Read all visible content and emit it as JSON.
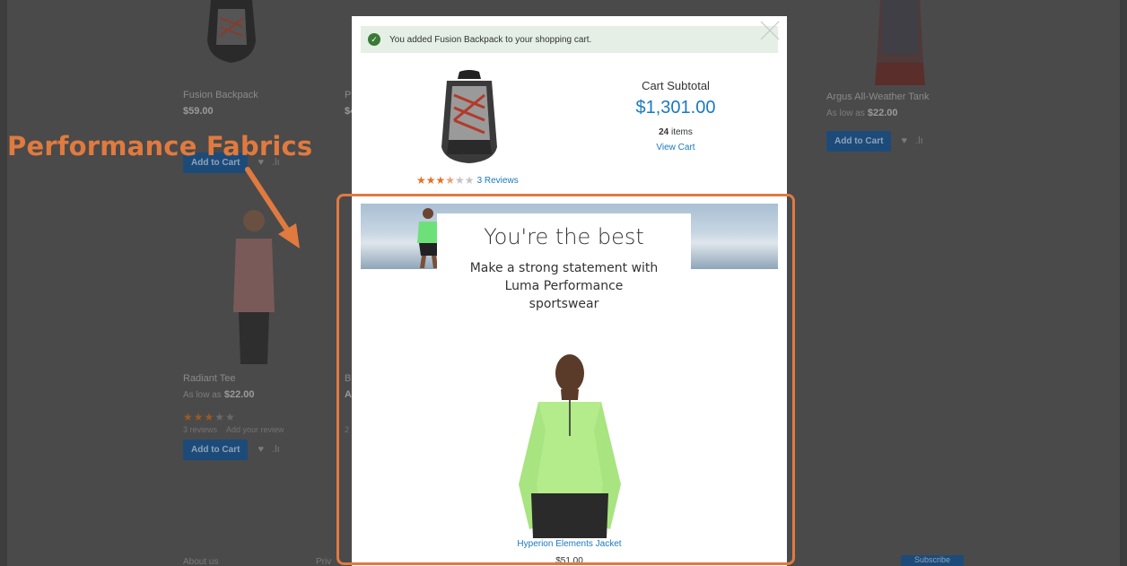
{
  "background_page": {
    "products_row1": [
      {
        "name": "Fusion Backpack",
        "price": "$59.00",
        "add_label": "Add to Cart"
      },
      {
        "name": "Argus All-Weather Tank",
        "price_prefix": "As low as",
        "price": "$22.00",
        "add_label": "Add to Cart"
      }
    ],
    "products_row2": [
      {
        "name": "Radiant Tee",
        "price_prefix": "As low as",
        "price": "$22.00",
        "stars": "★★★",
        "stars_off": "★★",
        "reviews": "3 reviews",
        "add_review": "Add your review",
        "add_label": "Add to Cart"
      }
    ],
    "fragments": {
      "col2_row1_name": "Pu",
      "col2_row1_price": "$4",
      "col2_row2_name": "Br",
      "col2_row2_price": "As",
      "col2_row2_reviews": "2"
    },
    "footer": {
      "about": "About us",
      "privacy": "Priv",
      "subscribe": "Subscribe"
    }
  },
  "annotation": {
    "label": "Performance Fabrics",
    "color": "#e07a3f"
  },
  "modal": {
    "message": "You added Fusion Backpack to your shopping cart.",
    "close_icon": "close-icon",
    "product": {
      "stars": "★★★",
      "half_star": "★",
      "stars_off": "★★",
      "reviews_link": "3 Reviews"
    },
    "cart": {
      "subtotal_label": "Cart Subtotal",
      "subtotal_amount": "$1,301.00",
      "items_count": "24",
      "items_label": "items",
      "view_cart": "View Cart"
    },
    "promo": {
      "title": "You're the best",
      "subtitle_line1": "Make a strong statement with",
      "subtitle_line2": "Luma Performance",
      "subtitle_line3": "sportswear"
    },
    "featured": {
      "name": "Hyperion Elements Jacket",
      "price": "$51.00"
    }
  },
  "colors": {
    "accent": "#1979c3",
    "annotation": "#e07a3f",
    "success": "#3a7a35",
    "success_bg": "#e5efe5"
  }
}
